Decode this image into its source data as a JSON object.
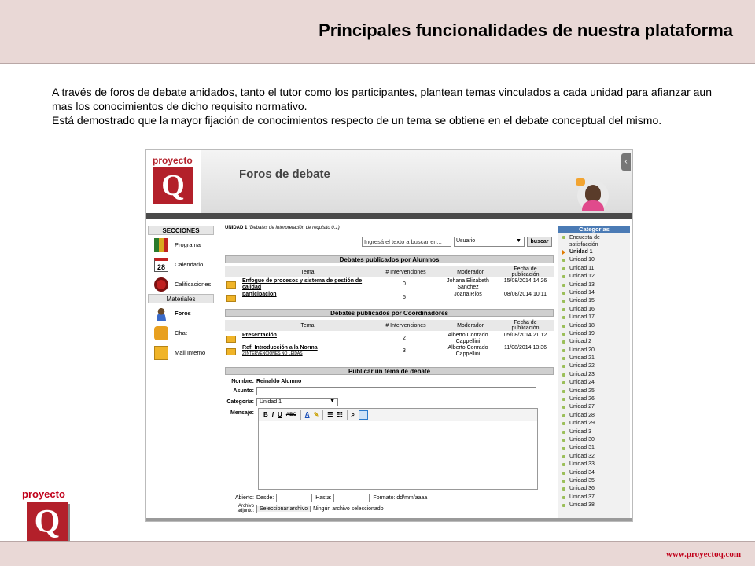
{
  "slide": {
    "title": "Principales funcionalidades de nuestra plataforma",
    "paragraph1": "A través de foros de debate anidados, tanto el tutor como los participantes, plantean temas vinculados a cada unidad para afianzar aun mas los conocimientos de dicho requisito normativo.",
    "paragraph2": "Está demostrado que la mayor fijación de conocimientos respecto de un tema se obtiene en el debate conceptual del mismo.",
    "logo_word": "proyecto",
    "logo_letter": "Q",
    "footer_url": "www.proyectoq.com",
    "colors": {
      "band": "#e9d8d6",
      "brand_red": "#b3202a",
      "url_red": "#c0001a"
    }
  },
  "app": {
    "logo_word": "proyecto",
    "logo_letter": "Q",
    "page_title": "Foros de debate",
    "nav": {
      "sections_label": "SECCIONES",
      "items": [
        {
          "label": "Programa",
          "icon": "books-icon"
        },
        {
          "label": "Calendario",
          "icon": "calendar-icon",
          "day": "28"
        },
        {
          "label": "Calificaciones",
          "icon": "ribbon-icon"
        }
      ],
      "materials_label": "Materiales",
      "materials": [
        {
          "label": "Foros",
          "icon": "forum-icon"
        },
        {
          "label": "Chat",
          "icon": "chat-icon"
        },
        {
          "label": "Mail Interno",
          "icon": "mail-icon"
        }
      ]
    },
    "breadcrumb": {
      "unit": "UNIDAD 1",
      "detail": "(Debates de Interpretación de requisito 0.1)"
    },
    "search": {
      "placeholder": "Ingresá el texto a buscar en...",
      "select_value": "Usuario",
      "button": "buscar"
    },
    "students": {
      "title": "Debates publicados por Alumnos",
      "cols": [
        "Tema",
        "# Intervenciones",
        "Moderador",
        "Fecha de publicación"
      ],
      "rows": [
        {
          "tema": "Enfogue de procesos y sistema de gestión de calidad",
          "n": "0",
          "mod": "Johana Elizabeth Sanchez",
          "fecha": "15/08/2014 14:26"
        },
        {
          "tema": "participacion",
          "n": "5",
          "mod": "Joana Ríos",
          "fecha": "08/08/2014 10:11"
        }
      ]
    },
    "coords": {
      "title": "Debates publicados por Coordinadores",
      "cols": [
        "Tema",
        "# Intervenciones",
        "Moderador",
        "Fecha de publicación"
      ],
      "rows": [
        {
          "tema": "Presentación",
          "sub": "",
          "n": "2",
          "mod": "Alberto Conrado Cappellini",
          "fecha": "05/08/2014 21:12"
        },
        {
          "tema": "Ref: Introducción a la Norma",
          "sub": "2 INTERVENCIONES NO LEIDAS",
          "n": "3",
          "mod": "Alberto Conrado Cappellini",
          "fecha": "11/08/2014 13:36"
        }
      ]
    },
    "publish": {
      "title": "Publicar un tema de debate",
      "name_label": "Nombre:",
      "name_value": "Reinaldo Alumno",
      "subject_label": "Asunto:",
      "category_label": "Categoría:",
      "category_value": "Unidad 1",
      "message_label": "Mensaje:",
      "toolbar": {
        "bold": "B",
        "italic": "I",
        "underline": "U",
        "strike": "ABC",
        "font_color": "A"
      },
      "open_label": "Abierto:",
      "from_label": "Desde:",
      "to_label": "Hasta:",
      "format_label": "Formato: dd/mm/aaaa",
      "attach_label": "Archivo adjunto:",
      "attach_button": "Seleccionar archivo",
      "attach_status": "Ningún archivo seleccionado"
    },
    "categories": {
      "title": "Categorias",
      "items": [
        "Encuesta de satisfacción",
        "Unidad 1",
        "Unidad 10",
        "Unidad 11",
        "Unidad 12",
        "Unidad 13",
        "Unidad 14",
        "Unidad 15",
        "Unidad 16",
        "Unidad 17",
        "Unidad 18",
        "Unidad 19",
        "Unidad 2",
        "Unidad 20",
        "Unidad 21",
        "Unidad 22",
        "Unidad 23",
        "Unidad 24",
        "Unidad 25",
        "Unidad 26",
        "Unidad 27",
        "Unidad 28",
        "Unidad 29",
        "Unidad 3",
        "Unidad 30",
        "Unidad 31",
        "Unidad 32",
        "Unidad 33",
        "Unidad 34",
        "Unidad 35",
        "Unidad 36",
        "Unidad 37",
        "Unidad 38"
      ],
      "active": "Unidad 1"
    }
  }
}
